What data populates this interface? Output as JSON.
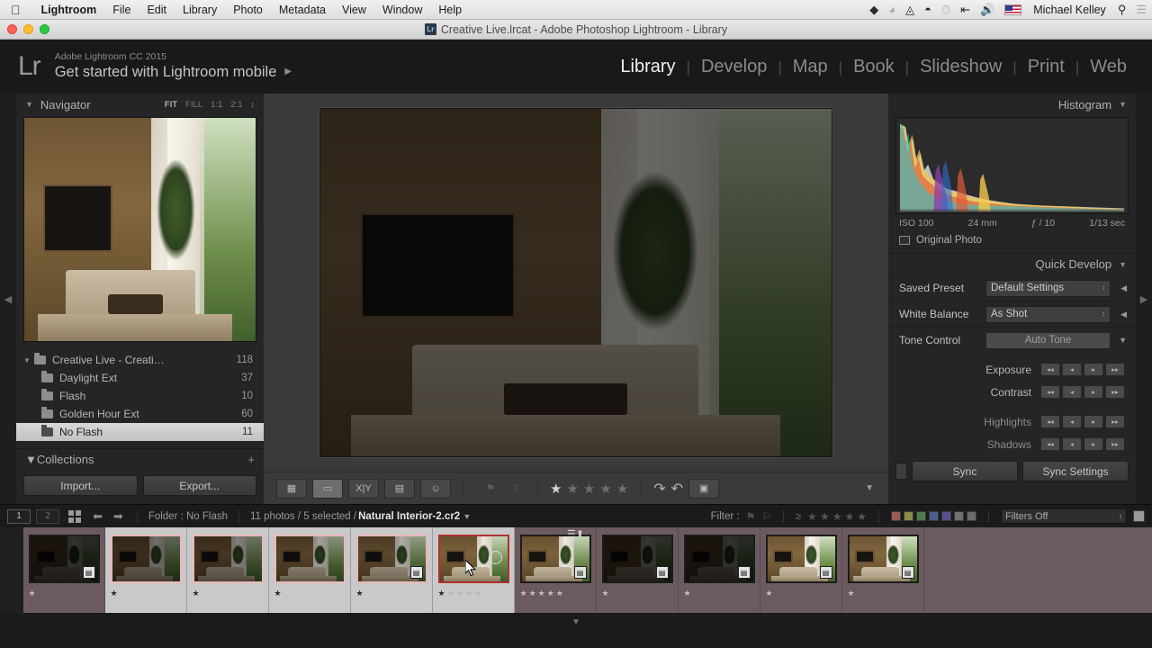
{
  "macmenu": {
    "apple": "apple-logo",
    "items": [
      "Lightroom",
      "File",
      "Edit",
      "Library",
      "Photo",
      "Metadata",
      "View",
      "Window",
      "Help"
    ],
    "right_icons": [
      "dropbox-icon",
      "creative-cloud-icon",
      "airplay-icon",
      "wifi-icon",
      "time-machine-icon",
      "bluetooth-icon",
      "volume-icon",
      "us-flag-icon"
    ],
    "user": "Michael Kelley",
    "search_icon": "search-icon",
    "list_icon": "notification-center-icon"
  },
  "window": {
    "title": "Creative Live.lrcat - Adobe Photoshop Lightroom - Library",
    "app_badge": "Lr"
  },
  "header": {
    "logo": "Lr",
    "identity_line1": "Adobe Lightroom CC 2015",
    "identity_line2": "Get started with Lightroom mobile",
    "identity_arrow": "▶",
    "modules": [
      {
        "label": "Library",
        "active": true
      },
      {
        "label": "Develop",
        "active": false
      },
      {
        "label": "Map",
        "active": false
      },
      {
        "label": "Book",
        "active": false
      },
      {
        "label": "Slideshow",
        "active": false
      },
      {
        "label": "Print",
        "active": false
      },
      {
        "label": "Web",
        "active": false
      }
    ]
  },
  "left_panel": {
    "navigator": {
      "title": "Navigator",
      "zoom_options": [
        {
          "label": "FIT",
          "active": true
        },
        {
          "label": "FILL",
          "active": false
        },
        {
          "label": "1:1",
          "active": false
        },
        {
          "label": "2:1",
          "active": false
        }
      ]
    },
    "folders": [
      {
        "name": "Creative Live - Creati…",
        "count": "118",
        "level": 0,
        "selected": false,
        "expanded": true
      },
      {
        "name": "Daylight Ext",
        "count": "37",
        "level": 1,
        "selected": false
      },
      {
        "name": "Flash",
        "count": "10",
        "level": 1,
        "selected": false
      },
      {
        "name": "Golden Hour Ext",
        "count": "60",
        "level": 1,
        "selected": false
      },
      {
        "name": "No Flash",
        "count": "11",
        "level": 1,
        "selected": true
      }
    ],
    "collections_title": "Collections",
    "import_label": "Import...",
    "export_label": "Export..."
  },
  "right_panel": {
    "histogram": {
      "title": "Histogram",
      "iso": "ISO 100",
      "focal": "24 mm",
      "aperture": "ƒ / 10",
      "shutter": "1/13 sec",
      "original_photo_label": "Original Photo"
    },
    "quick_develop": {
      "title": "Quick Develop",
      "saved_preset_label": "Saved Preset",
      "saved_preset_value": "Default Settings",
      "white_balance_label": "White Balance",
      "white_balance_value": "As Shot",
      "tone_control_label": "Tone Control",
      "auto_tone_label": "Auto Tone",
      "sliders": [
        {
          "label": "Exposure",
          "dim": false
        },
        {
          "label": "Contrast",
          "dim": false
        },
        {
          "label": "Highlights",
          "dim": true
        },
        {
          "label": "Shadows",
          "dim": true
        }
      ]
    },
    "sync_label": "Sync",
    "sync_settings_label": "Sync Settings"
  },
  "toolbar": {
    "views": [
      {
        "name": "grid-view-icon",
        "glyph": "▓",
        "active": false
      },
      {
        "name": "loupe-view-icon",
        "glyph": "▭",
        "active": true
      },
      {
        "name": "compare-view-icon",
        "glyph": "X|Y",
        "active": false
      },
      {
        "name": "survey-view-icon",
        "glyph": "▤",
        "active": false
      },
      {
        "name": "people-view-icon",
        "glyph": "☺",
        "active": false
      }
    ],
    "flag_icon": "flag-icon",
    "reject_icon": "reject-flag-icon",
    "rating": 1,
    "rating_max": 5,
    "rotate_left_icon": "rotate-left-icon",
    "rotate_right_icon": "rotate-right-icon",
    "face_crop_icon": "face-region-icon",
    "toolbar_chevron": "chevron-down-icon"
  },
  "strip_bar": {
    "screen1": "1",
    "screen2": "2",
    "grid_icon": "filmstrip-grid-icon",
    "back_icon": "nav-back-icon",
    "forward_icon": "nav-forward-icon",
    "source_label": "Folder : No Flash",
    "count_text": "11 photos / 5 selected / ",
    "current_file": "Natural Interior-2.cr2",
    "filter_label": "Filter :",
    "flag_filter_icon": "flag-filter-icon",
    "reject_filter_icon": "reject-filter-icon",
    "rating_op": "≥",
    "color_labels": [
      "#9c5a5a",
      "#8a8a44",
      "#4f7a4f",
      "#4a5f8a",
      "#5a4f8a",
      "#707070",
      "#6b6b6b"
    ],
    "filters_value": "Filters Off"
  },
  "filmstrip": {
    "cells": [
      {
        "selected": false,
        "active": false,
        "stars": 1,
        "badge": true,
        "tone": "dark"
      },
      {
        "selected": true,
        "active": false,
        "stars": 1,
        "badge": false,
        "tone": "dim"
      },
      {
        "selected": true,
        "active": false,
        "stars": 1,
        "badge": false,
        "tone": "dim"
      },
      {
        "selected": true,
        "active": false,
        "stars": 1,
        "badge": false,
        "tone": "mid"
      },
      {
        "selected": true,
        "active": false,
        "stars": 1,
        "badge": true,
        "tone": "mid"
      },
      {
        "selected": true,
        "active": true,
        "stars": 1,
        "badge": false,
        "tone": "bright"
      },
      {
        "selected": false,
        "active": false,
        "stars": 5,
        "badge": true,
        "tone": "bright"
      },
      {
        "selected": false,
        "active": false,
        "stars": 1,
        "badge": true,
        "tone": "dark"
      },
      {
        "selected": false,
        "active": false,
        "stars": 1,
        "badge": true,
        "tone": "dark"
      },
      {
        "selected": false,
        "active": false,
        "stars": 1,
        "badge": true,
        "tone": "bright"
      },
      {
        "selected": false,
        "active": false,
        "stars": 1,
        "badge": true,
        "tone": "bright"
      }
    ],
    "sort_icon": "sort-order-icon"
  },
  "colors": {
    "app_bg": "#252525",
    "center_bg": "#3a3a3a",
    "accent_selected": "#d8d8d8",
    "filmstrip_selected": "#c9c9c9",
    "filmstrip_unselected": "#6b5b5f",
    "active_thumb_border": "#b03030"
  }
}
